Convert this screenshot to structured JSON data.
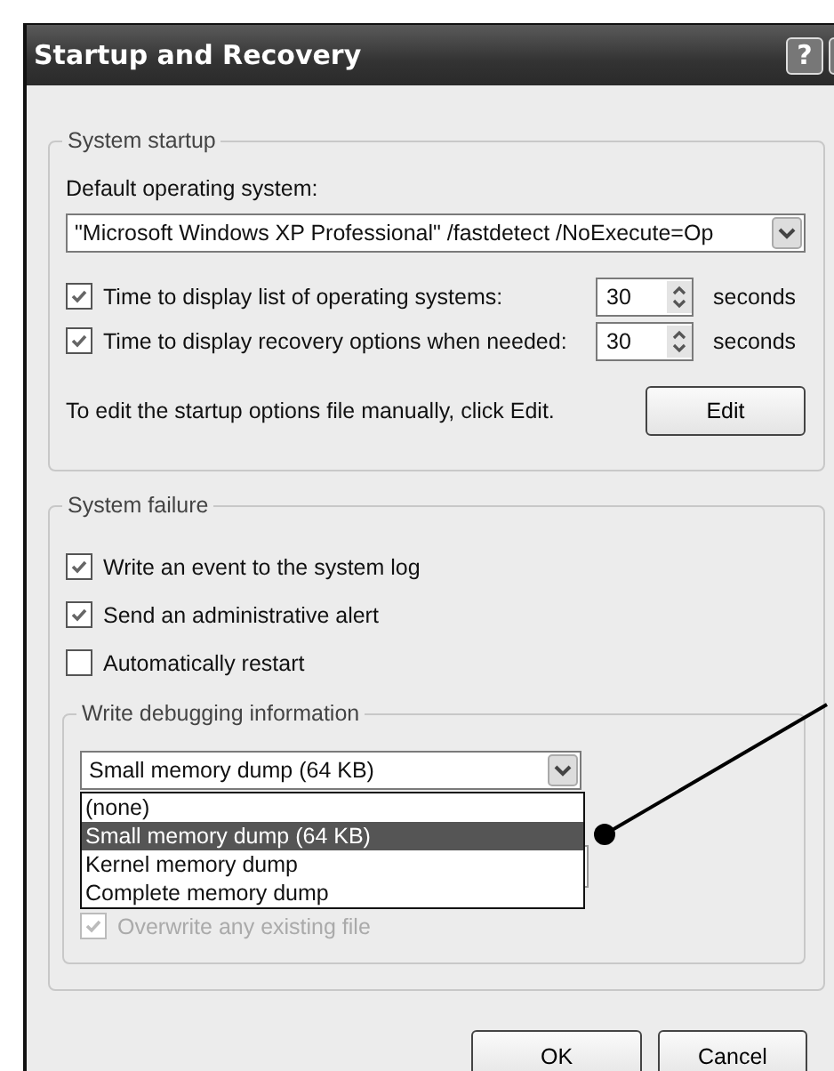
{
  "window": {
    "title": "Startup and Recovery",
    "help_button": "?"
  },
  "system_startup": {
    "legend": "System startup",
    "default_os_label": "Default operating system:",
    "default_os": "\"Microsoft Windows XP Professional\" /fastdetect /NoExecute=Op",
    "timers": [
      {
        "label": "Time to display list of operating systems:",
        "checked": true,
        "value": "30",
        "unit": "seconds"
      },
      {
        "label": "Time to display recovery options when needed:",
        "checked": true,
        "value": "30",
        "unit": "seconds"
      }
    ],
    "edit_hint": "To edit the startup options file manually, click Edit.",
    "edit_button": "Edit"
  },
  "system_failure": {
    "legend": "System failure",
    "options": [
      {
        "label": "Write an event to the system log",
        "checked": true
      },
      {
        "label": "Send an administrative alert",
        "checked": true
      },
      {
        "label": "Automatically restart",
        "checked": false
      }
    ],
    "debugging": {
      "legend": "Write debugging information",
      "dump_type": {
        "value": "Small memory dump (64 KB)",
        "expanded": true,
        "options": [
          {
            "label": "(none)",
            "selected": false
          },
          {
            "label": "Small memory dump (64 KB)",
            "selected": true
          },
          {
            "label": "Kernel memory dump",
            "selected": false
          },
          {
            "label": "Complete memory dump",
            "selected": false
          }
        ]
      },
      "overwrite": {
        "label": "Overwrite any existing file",
        "checked": true,
        "disabled": true
      }
    }
  },
  "buttons": [
    "OK",
    "Cancel"
  ]
}
